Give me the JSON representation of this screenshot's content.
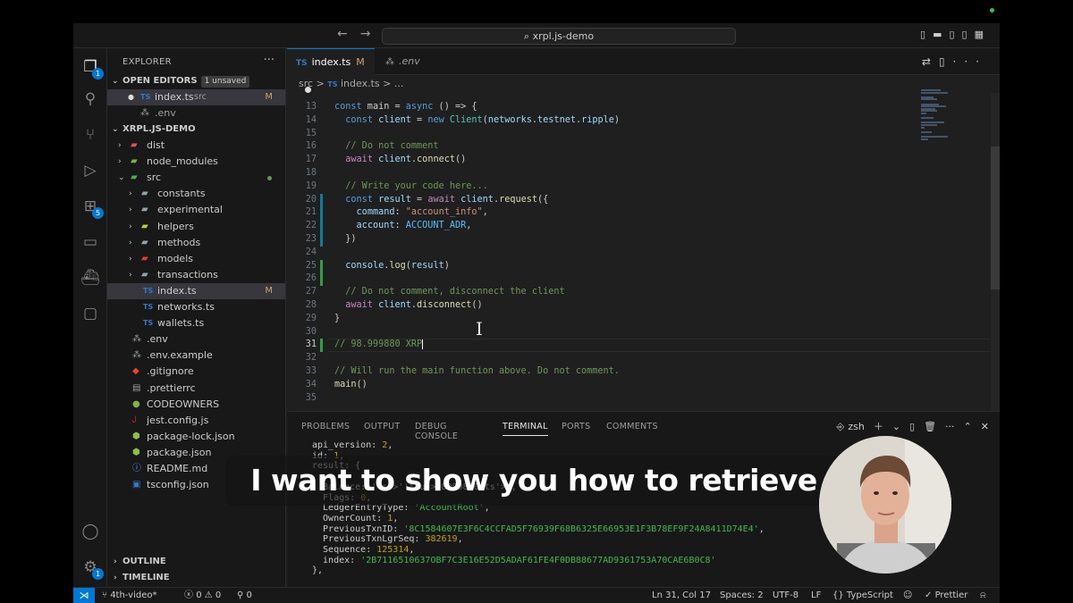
{
  "titlebar": {
    "search": "xrpl.js-demo"
  },
  "activity_badges": {
    "explorer": "1",
    "extensions": "5",
    "accounts": "1"
  },
  "sidebar": {
    "header": "EXPLORER",
    "open_editors": "OPEN EDITORS",
    "unsaved": "1 unsaved",
    "open_files": [
      {
        "name": "index.ts",
        "desc": "src",
        "status": "M"
      },
      {
        "name": ".env",
        "desc": "",
        "status": ""
      }
    ],
    "project": "XRPL.JS-DEMO",
    "tree": [
      {
        "name": "dist",
        "status": ""
      },
      {
        "name": "node_modules",
        "status": ""
      },
      {
        "name": "src",
        "status": ""
      },
      {
        "name": "constants",
        "status": ""
      },
      {
        "name": "experimental",
        "status": ""
      },
      {
        "name": "helpers",
        "status": ""
      },
      {
        "name": "methods",
        "status": ""
      },
      {
        "name": "models",
        "status": ""
      },
      {
        "name": "transactions",
        "status": ""
      },
      {
        "name": "index.ts",
        "status": "M"
      },
      {
        "name": "networks.ts",
        "status": ""
      },
      {
        "name": "wallets.ts",
        "status": ""
      },
      {
        "name": ".env",
        "status": ""
      },
      {
        "name": ".env.example",
        "status": ""
      },
      {
        "name": ".gitignore",
        "status": ""
      },
      {
        "name": ".prettierrc",
        "status": ""
      },
      {
        "name": "CODEOWNERS",
        "status": ""
      },
      {
        "name": "jest.config.js",
        "status": ""
      },
      {
        "name": "package-lock.json",
        "status": ""
      },
      {
        "name": "package.json",
        "status": ""
      },
      {
        "name": "README.md",
        "status": ""
      },
      {
        "name": "tsconfig.json",
        "status": ""
      }
    ],
    "outline": "OUTLINE",
    "timeline": "TIMELINE"
  },
  "tabs": [
    {
      "label": "index.ts",
      "mod": "M"
    },
    {
      "label": ".env",
      "mod": ""
    }
  ],
  "breadcrumb": {
    "folder": "src",
    "sep": ">",
    "file": "index.ts",
    "rest": "> ..."
  },
  "code": {
    "line_numbers": [
      "13",
      "14",
      "15",
      "16",
      "17",
      "18",
      "19",
      "20",
      "21",
      "22",
      "23",
      "24",
      "25",
      "26",
      "27",
      "28",
      "29",
      "30",
      "31",
      "32",
      "33",
      "34",
      "35"
    ],
    "lines": [
      "const main = async () => {",
      "  const client = new Client(networks.testnet.ripple)",
      "",
      "  // Do not comment",
      "  await client.connect()",
      "",
      "  // Write your code here...",
      "  const result = await client.request({",
      "    command: \"account_info\",",
      "    account: ACCOUNT_ADR,",
      "  })",
      "",
      "  console.log(result)",
      "",
      "  // Do not comment, disconnect the client",
      "  await client.disconnect()",
      "}",
      "",
      "// 98.999880 XRP",
      "",
      "// Will run the main function above. Do not comment.",
      "main()",
      ""
    ]
  },
  "panel": {
    "tabs": [
      "PROBLEMS",
      "OUTPUT",
      "DEBUG CONSOLE",
      "TERMINAL",
      "PORTS",
      "COMMENTS"
    ],
    "active_tab": "TERMINAL",
    "shell": "zsh",
    "terminal_lines": [
      "api_version: 2,",
      "id: 1,",
      "result: {",
      "",
      "  Balance: '98999880',",
      "  Flags: 0,",
      "  LedgerEntryType: 'AccountRoot',",
      "  OwnerCount: 1,",
      "  PreviousTxnID: '8C1584607E3F6C4CCFAD5F76939F68B6325E66953E1F3B78EF9F24A8411D74E4',",
      "  PreviousTxnLgrSeq: 382619,",
      "  Sequence: 125314,",
      "  index: '2B7116510637OBF7C3E16E52D5ADAF61FE4F0DB88677AD9361753A70CAE6B0C8'",
      "},"
    ]
  },
  "status": {
    "branch": "4th-video*",
    "errors": "0",
    "warnings": "0",
    "ports": "0",
    "position": "Ln 31, Col 17",
    "spaces": "Spaces: 2",
    "encoding": "UTF-8",
    "eol": "LF",
    "language": "TypeScript",
    "formatter": "Prettier"
  },
  "caption": "I want to show you how to retrieve"
}
